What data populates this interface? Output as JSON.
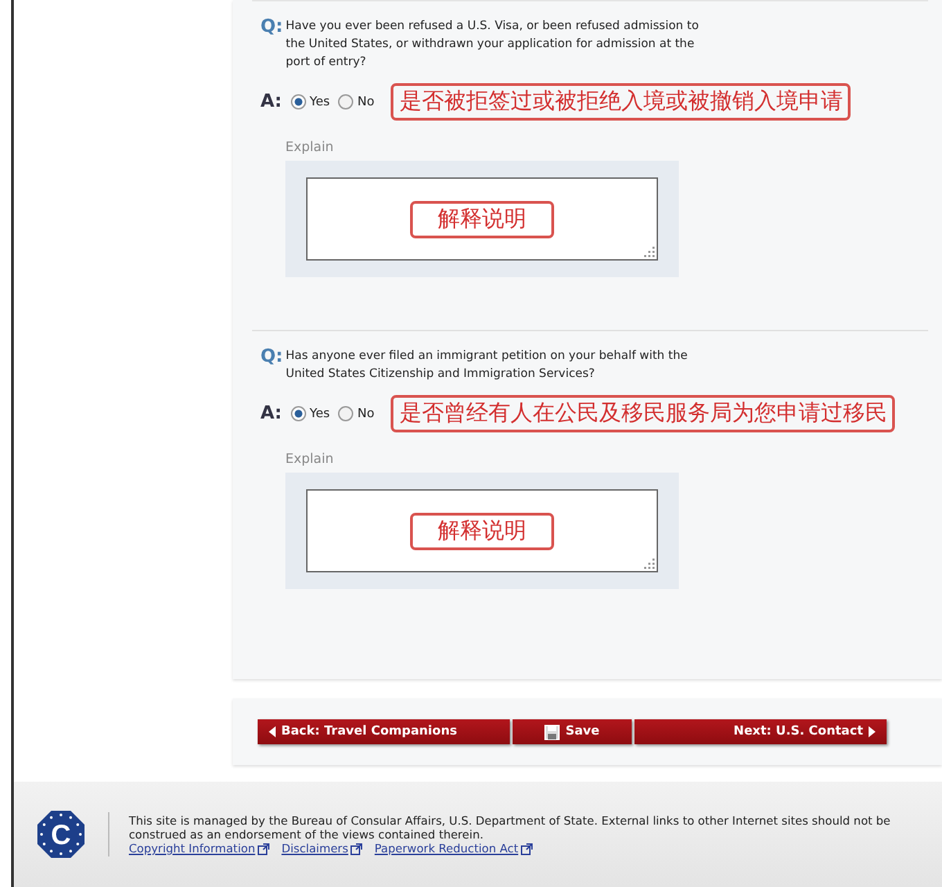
{
  "questions": [
    {
      "q_marker": "Q:",
      "question": "Have you ever been refused a U.S. Visa, or been refused admission to the United States, or withdrawn your application for admission at the port of entry?",
      "a_marker": "A:",
      "options": [
        {
          "label": "Yes",
          "selected": true
        },
        {
          "label": "No",
          "selected": false
        }
      ],
      "note": "是否被拒签过或被拒绝入境或被撤销入境申请",
      "explain_label": "Explain",
      "explain_note": "解释说明"
    },
    {
      "q_marker": "Q:",
      "question": "Has anyone ever filed an immigrant petition on your behalf with the United States Citizenship and Immigration Services?",
      "a_marker": "A:",
      "options": [
        {
          "label": "Yes",
          "selected": true
        },
        {
          "label": "No",
          "selected": false
        }
      ],
      "note": "是否曾经有人在公民及移民服务局为您申请过移民",
      "explain_label": "Explain",
      "explain_note": "解释说明"
    }
  ],
  "nav_buttons": [
    {
      "kind": "back",
      "label": "Back: Travel Companions"
    },
    {
      "kind": "save",
      "label": "Save"
    },
    {
      "kind": "next",
      "label": "Next: U.S. Contact"
    }
  ],
  "footer": {
    "text": "This site is managed by the Bureau of Consular Affairs, U.S. Department of State. External links to other Internet sites should not be construed as an endorsement of the views contained therein.",
    "logo_letter": "C",
    "links": [
      "Copyright Information",
      "Disclaimers",
      "Paperwork Reduction Act"
    ]
  }
}
